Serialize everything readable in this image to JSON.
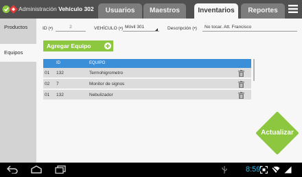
{
  "header": {
    "title_prefix": "Administración",
    "title_vehicle": "Vehículo 302",
    "logo_icon": "logo-icon",
    "tabs": [
      {
        "label": "Usuarios",
        "active": false
      },
      {
        "label": "Maestros",
        "active": false
      },
      {
        "label": "Inventarios",
        "active": true
      },
      {
        "label": "Reportes",
        "active": false
      }
    ],
    "menu_icon": "menu-icon"
  },
  "sidebar": {
    "items": [
      {
        "label": "Productos",
        "active": false
      },
      {
        "label": "Equipos",
        "active": true
      }
    ]
  },
  "form": {
    "id_label": "ID (•)",
    "id_value": "2",
    "vehicle_label": "VEHÍCULO (•)",
    "vehicle_value": "Móvil 301",
    "description_label": "Descripción (•)",
    "description_value": "No tocar. Att. Francisco"
  },
  "add_button": {
    "label": "Agregar Equipo",
    "icon": "plus-circle-icon"
  },
  "table": {
    "headers": {
      "id": "ID",
      "equipment": "EQUIPO"
    },
    "rows": [
      {
        "index": "01",
        "id": "132",
        "equipment": "Termohigrometro"
      },
      {
        "index": "02",
        "id": "7",
        "equipment": "Monitor de signos"
      },
      {
        "index": "01",
        "id": "132",
        "equipment": "Nebulizador"
      }
    ],
    "row_action_icon": "trash-icon"
  },
  "update_button": {
    "label": "Actualizar"
  },
  "system_bar": {
    "time": "8:59",
    "nav_icons": [
      "back-icon",
      "home-icon",
      "recent-apps-icon"
    ],
    "status_icons": [
      "usb-icon",
      "screenshot-icon",
      "wifi-off-icon",
      "signal-icon"
    ]
  },
  "colors": {
    "accent_green": "#8dc63f",
    "table_header_blue": "#3b8fd9",
    "top_bar": "#505050",
    "clock_blue": "#33b5e5"
  }
}
